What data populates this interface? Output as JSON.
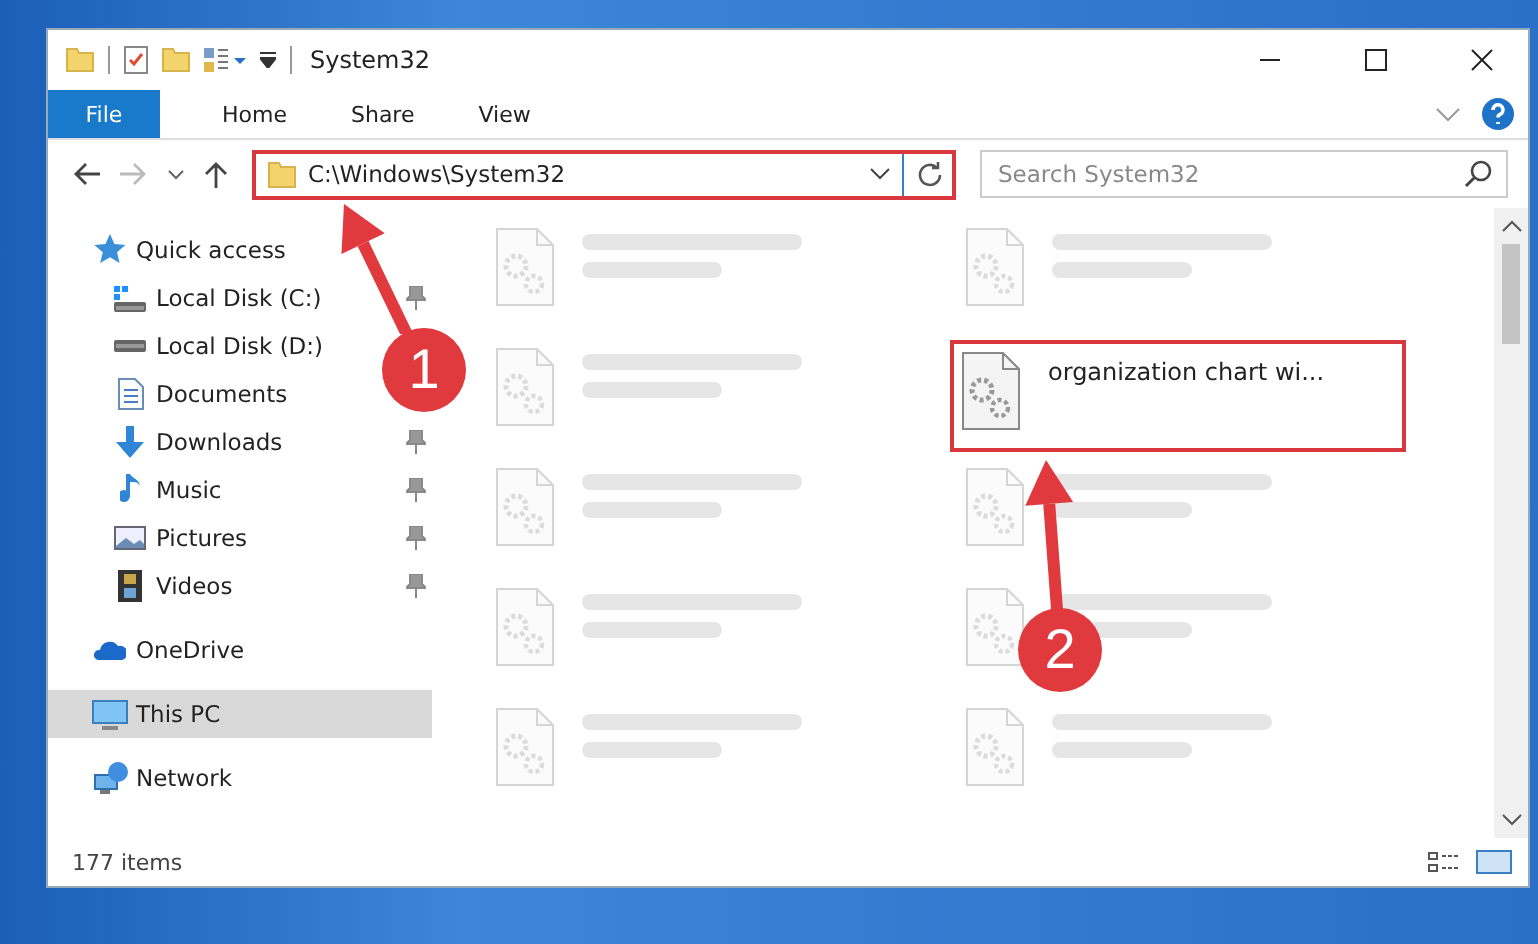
{
  "window": {
    "title": "System32"
  },
  "ribbon": {
    "tabs": [
      {
        "label": "File",
        "kind": "file"
      },
      {
        "label": "Home",
        "kind": "plain"
      },
      {
        "label": "Share",
        "kind": "plain"
      },
      {
        "label": "View",
        "kind": "plain"
      }
    ]
  },
  "address_bar": {
    "path": "C:\\Windows\\System32",
    "highlighted": true
  },
  "search": {
    "placeholder": "Search System32"
  },
  "sidebar": {
    "items": [
      {
        "label": "Quick access",
        "kind": "star",
        "selected": false,
        "children": [
          {
            "label": "Local Disk (C:)",
            "kind": "sysdrive",
            "pinned": true
          },
          {
            "label": "Local Disk (D:)",
            "kind": "drive",
            "pinned": false
          },
          {
            "label": "Documents",
            "kind": "docs",
            "pinned": false
          },
          {
            "label": "Downloads",
            "kind": "download",
            "pinned": true
          },
          {
            "label": "Music",
            "kind": "music",
            "pinned": true
          },
          {
            "label": "Pictures",
            "kind": "pictures",
            "pinned": true
          },
          {
            "label": "Videos",
            "kind": "videos",
            "pinned": true
          }
        ]
      },
      {
        "label": "OneDrive",
        "kind": "cloud",
        "selected": false
      },
      {
        "label": "This PC",
        "kind": "pc",
        "selected": true
      },
      {
        "label": "Network",
        "kind": "network",
        "selected": false
      }
    ]
  },
  "files": [
    {
      "blurred": true,
      "highlighted": false
    },
    {
      "blurred": true,
      "highlighted": false
    },
    {
      "blurred": true,
      "highlighted": false
    },
    {
      "name": "organization chart wi...",
      "blurred": false,
      "highlighted": true
    },
    {
      "blurred": true,
      "highlighted": false
    },
    {
      "blurred": true,
      "highlighted": false
    },
    {
      "blurred": true,
      "highlighted": false
    },
    {
      "blurred": true,
      "highlighted": false
    },
    {
      "blurred": true,
      "highlighted": false
    },
    {
      "blurred": true,
      "highlighted": false
    }
  ],
  "status_bar": {
    "text": "177 items"
  },
  "annotations": [
    {
      "number": "1"
    },
    {
      "number": "2"
    }
  ]
}
